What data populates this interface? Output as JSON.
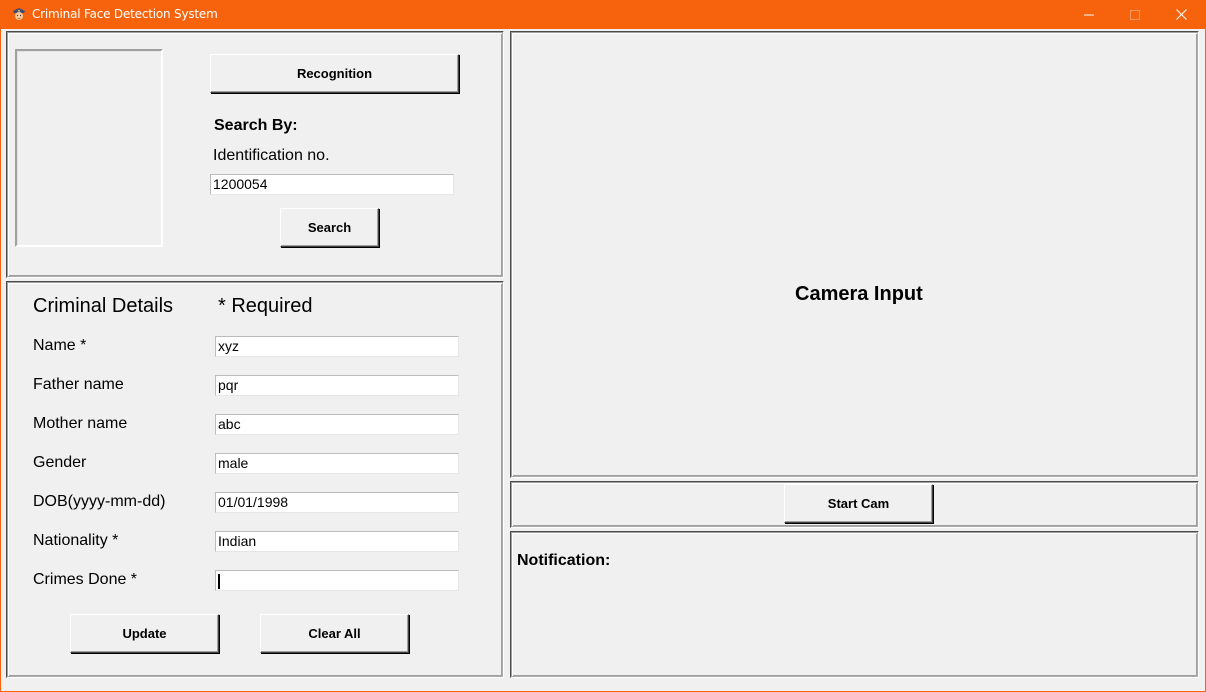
{
  "window": {
    "title": "Criminal Face Detection System",
    "accent_color": "#f7630c",
    "controls": {
      "minimize": "—",
      "maximize": "☐",
      "close": "✕"
    }
  },
  "search_panel": {
    "recognition_label": "Recognition",
    "search_by_label": "Search By:",
    "identification_label": "Identification no.",
    "identification_value": "1200054",
    "search_label": "Search"
  },
  "details_panel": {
    "title": "Criminal Details",
    "required_note": "* Required",
    "fields": [
      {
        "label": "Name *",
        "value": "xyz"
      },
      {
        "label": "Father name",
        "value": "pqr"
      },
      {
        "label": "Mother name",
        "value": "abc"
      },
      {
        "label": "Gender",
        "value": "male"
      },
      {
        "label": "DOB(yyyy-mm-dd)",
        "value": "01/01/1998"
      },
      {
        "label": "Nationality *",
        "value": "Indian"
      },
      {
        "label": "Crimes Done *",
        "value": ""
      }
    ],
    "update_label": "Update",
    "clear_label": "Clear All"
  },
  "camera_panel": {
    "camera_label": "Camera Input",
    "start_cam_label": "Start Cam"
  },
  "notification_panel": {
    "label": "Notification:"
  }
}
